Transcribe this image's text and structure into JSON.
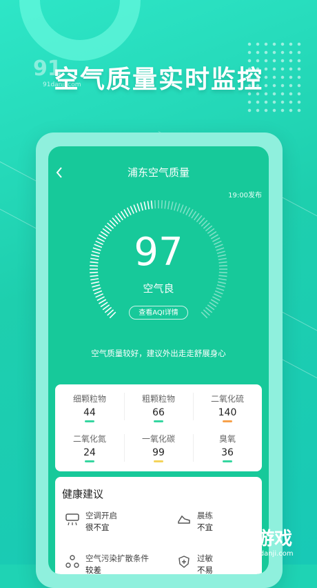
{
  "headline": "空气质量实时监控",
  "watermark": {
    "logo": "91",
    "site": "91danji.com"
  },
  "screen": {
    "back_icon": "chevron-left",
    "title": "浦东空气质量",
    "published": "19:00发布",
    "aqi_value": "97",
    "aqi_level": "空气良",
    "details_button": "查看AQI详情",
    "advice": "空气质量较好，建议外出走走舒展身心",
    "gauge_fill_fraction": 0.48,
    "pollutants": [
      {
        "name": "细颗粒物",
        "value": "44",
        "color": "#35d6a0"
      },
      {
        "name": "粗颗粒物",
        "value": "66",
        "color": "#35d6a0"
      },
      {
        "name": "二氧化硫",
        "value": "140",
        "color": "#f7a14b"
      },
      {
        "name": "二氧化氮",
        "value": "24",
        "color": "#35d6a0"
      },
      {
        "name": "一氧化碳",
        "value": "99",
        "color": "#f4d35a"
      },
      {
        "name": "臭氧",
        "value": "36",
        "color": "#35d6a0"
      }
    ],
    "health": {
      "title": "健康建议",
      "tips": [
        {
          "icon": "air-conditioner",
          "label": "空调开启",
          "value": "很不宜"
        },
        {
          "icon": "running-shoe",
          "label": "晨练",
          "value": "不宜"
        },
        {
          "icon": "pollution-spread",
          "label": "空气污染扩散条件",
          "value": "较差"
        },
        {
          "icon": "allergy",
          "label": "过敏",
          "value": "不易"
        }
      ]
    }
  },
  "brand": {
    "name": "91游戏",
    "domain": "91danji.com"
  },
  "colors": {
    "accent": "#17c99a",
    "background": "#1fd3b4"
  }
}
